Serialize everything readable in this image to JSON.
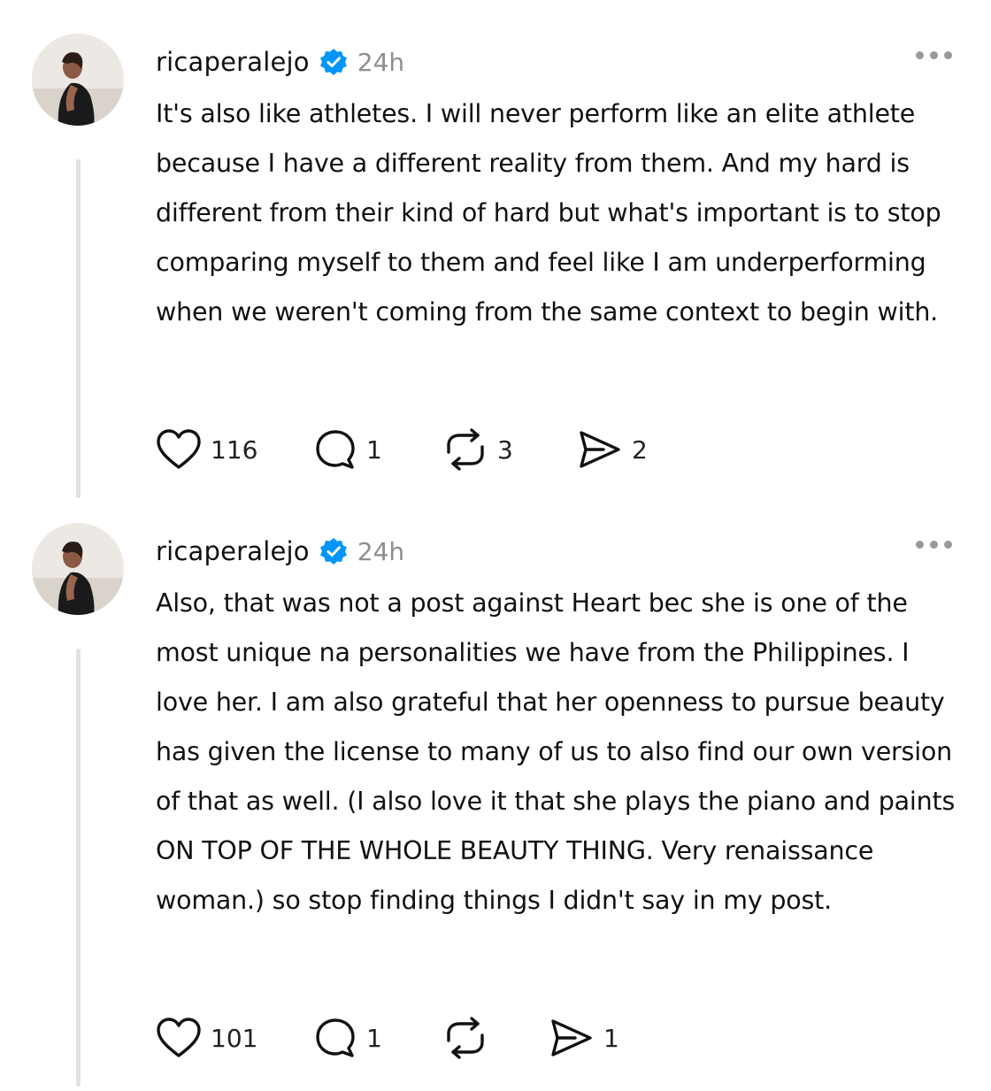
{
  "posts": [
    {
      "username": "ricaperalejo",
      "time": "24h",
      "verified": true,
      "text": "It's also like athletes. I will never perform like an elite athlete because I have a different reality from them. And my hard is different from their kind of hard but what's important is to stop comparing myself to them and feel like I am underperforming when we weren't coming from the same context to begin with.",
      "likes": "116",
      "replies": "1",
      "reposts": "3",
      "shares": "2"
    },
    {
      "username": "ricaperalejo",
      "time": "24h",
      "verified": true,
      "text": "Also, that was not a post against Heart bec she is one of the most unique na personalities we have from the Philippines. I love her. I am also grateful that her openness to pursue beauty has given the license to many of us to also find our own version of that as well. (I also love it that she plays the piano and paints ON TOP OF THE WHOLE BEAUTY THING. Very renaissance woman.) so stop finding things I didn't say in my post.",
      "likes": "101",
      "replies": "1",
      "reposts": "",
      "shares": "1"
    }
  ],
  "colors": {
    "verified": "#0095f6",
    "thread_line": "#e2e2e2",
    "muted": "#8e8e8e"
  },
  "icons": [
    "verified-badge-icon",
    "more-icon",
    "heart-icon",
    "comment-icon",
    "repost-icon",
    "share-icon"
  ]
}
